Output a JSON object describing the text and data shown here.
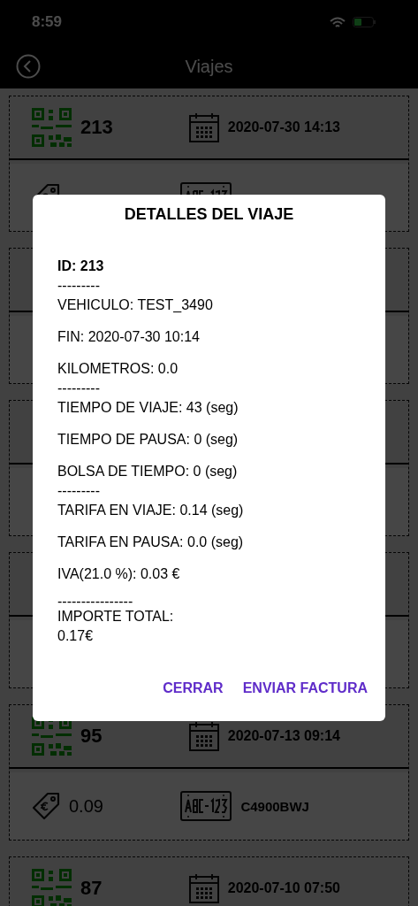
{
  "status_bar": {
    "time": "8:59"
  },
  "header": {
    "title": "Viajes"
  },
  "trips": [
    {
      "id": "213",
      "date": "2020-07-30 14:13"
    },
    {
      "id": "95",
      "date": "2020-07-13 09:14",
      "amount": "0.09",
      "plate": "C4900BWJ"
    },
    {
      "id": "87",
      "date": "2020-07-10 07:50"
    }
  ],
  "dialog": {
    "title": "DETALLES DEL VIAJE",
    "lines": [
      {
        "kind": "heading",
        "text": "ID: 213"
      },
      {
        "kind": "separator",
        "text": "---------"
      },
      {
        "kind": "field",
        "text": "VEHICULO: TEST_3490"
      },
      {
        "kind": "field",
        "text": "FIN: 2020-07-30 10:14"
      },
      {
        "kind": "field",
        "text": "KILOMETROS: 0.0"
      },
      {
        "kind": "separator",
        "text": "---------"
      },
      {
        "kind": "field",
        "text": "TIEMPO DE VIAJE: 43 (seg)"
      },
      {
        "kind": "field",
        "text": "TIEMPO DE PAUSA: 0 (seg)"
      },
      {
        "kind": "field",
        "text": "BOLSA DE TIEMPO: 0 (seg)"
      },
      {
        "kind": "separator",
        "text": "---------"
      },
      {
        "kind": "field",
        "text": "TARIFA EN VIAJE: 0.14 (seg)"
      },
      {
        "kind": "field",
        "text": "TARIFA EN PAUSA: 0.0 (seg)"
      },
      {
        "kind": "field",
        "text": "IVA(21.0 %): 0.03 €"
      },
      {
        "kind": "total",
        "rule": "----------------",
        "label": "IMPORTE TOTAL:",
        "amount": "0.17€"
      }
    ],
    "buttons": [
      "CERRAR",
      "ENVIAR FACTURA"
    ]
  }
}
